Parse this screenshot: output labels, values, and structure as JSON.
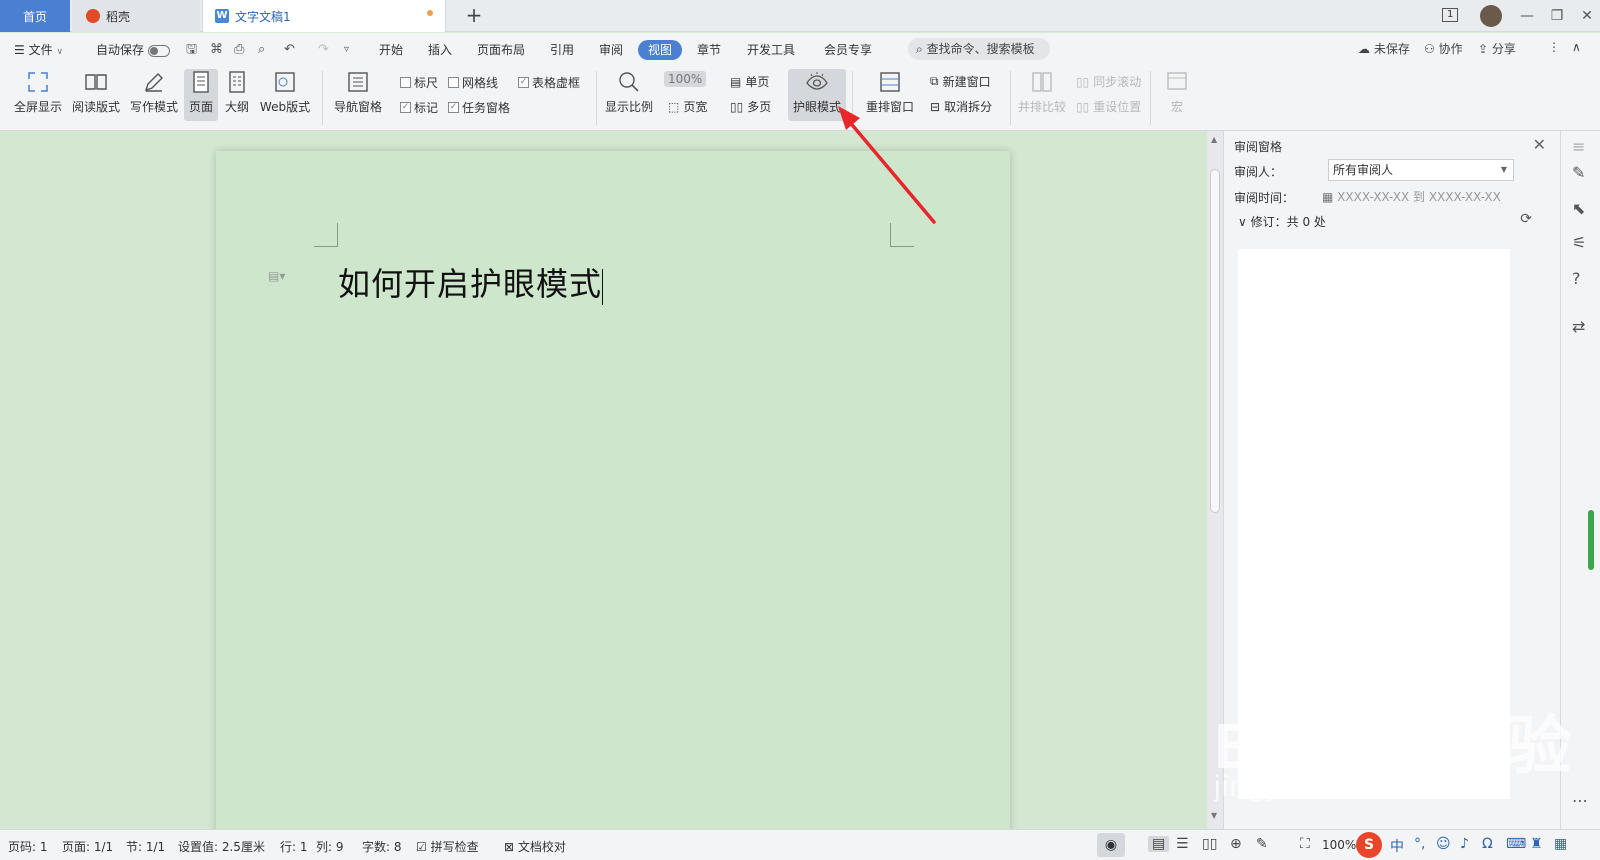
{
  "tabs": {
    "home": "首页",
    "daoke": "稻壳",
    "doc": "文字文稿1",
    "add": "+"
  },
  "window": {
    "badge": "1",
    "minimize": "—",
    "restore": "❐",
    "close": "✕"
  },
  "menubar": {
    "file": "文件",
    "autosave": "自动保存",
    "items": [
      "开始",
      "插入",
      "页面布局",
      "引用",
      "审阅",
      "视图",
      "章节",
      "开发工具",
      "会员专享"
    ],
    "active_index": 5,
    "search": "查找命令、搜索模板",
    "unsaved": "未保存",
    "collab": "协作",
    "share": "分享"
  },
  "ribbon": {
    "fullscreen": "全屏显示",
    "reading": "阅读版式",
    "writing": "写作模式",
    "page": "页面",
    "outline": "大纲",
    "web": "Web版式",
    "nav_pane": "导航窗格",
    "ruler": "标尺",
    "gridlines": "网格线",
    "table_border": "表格虚框",
    "marks": "标记",
    "task_pane": "任务窗格",
    "zoom": "显示比例",
    "zoom_100": "100%",
    "page_width": "页宽",
    "single_page": "单页",
    "multi_page": "多页",
    "eye_mode": "护眼模式",
    "rearrange": "重排窗口",
    "new_window": "新建窗口",
    "cancel_split": "取消拆分",
    "side_by_side": "并排比较",
    "sync_scroll": "同步滚动",
    "reset_pos": "重设位置",
    "macro": "宏"
  },
  "document": {
    "title": "如何开启护眼模式"
  },
  "review_pane": {
    "title": "审阅窗格",
    "reviewer_label": "审阅人：",
    "reviewer_value": "所有审阅人",
    "time_label": "审阅时间：",
    "time_range": "XXXX-XX-XX 到 XXXX-XX-XX",
    "revisions": "修订：共 0 处"
  },
  "statusbar": {
    "page_num": "页码: 1",
    "pages": "页面: 1/1",
    "section": "节: 1/1",
    "setting": "设置值: 2.5厘米",
    "row": "行: 1",
    "col": "列: 9",
    "words": "字数: 8",
    "spell": "拼写检查",
    "proofread": "文档校对",
    "zoom": "100%"
  },
  "watermark": {
    "main": "Bai du 经验",
    "sub": "jingyan.baidu.com"
  },
  "colors": {
    "accent": "#4b7fd1",
    "eye_green": "#d3e7d1",
    "arrow": "#e8262b"
  }
}
